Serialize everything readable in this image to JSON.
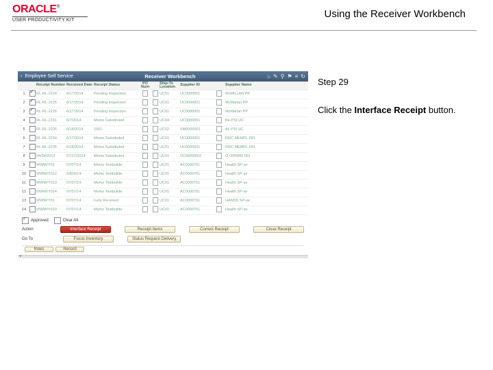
{
  "brand": {
    "name": "ORACLE",
    "tm": "®",
    "sub": "USER PRODUCTIVITY KIT"
  },
  "doc_title": "Using the Receiver Workbench",
  "step": {
    "label": "Step 29",
    "line1": "Click the ",
    "bold": "Interface Receipt",
    "line2": " button."
  },
  "titlebar": {
    "back": "‹",
    "left": "Employee Self Service",
    "center": "Receiver Workbench"
  },
  "icons": {
    "home": "⌂",
    "chat": "✎",
    "search": "⚲",
    "flag": "⚑",
    "menu": "≡",
    "refresh": "↻"
  },
  "columns": [
    "",
    "",
    "Receipt Number",
    "Received Date",
    "Receipt Status",
    "PO Num",
    "",
    "Ship-To Location",
    "Supplier ID",
    "",
    "Supplier Name"
  ],
  "rows": [
    {
      "n": "1",
      "chk": true,
      "a": "RL-RL-2224",
      "b": "6/17/2014",
      "c": "Pending Inspection",
      "f": "UC01",
      "g": "UC0000001",
      "i": "McMILLAN PP"
    },
    {
      "n": "2",
      "chk": true,
      "a": "RL-RL-2225",
      "b": "6/17/2014",
      "c": "Pending Inspection",
      "f": "UC01",
      "g": "UC0000001",
      "i": "McMahan PP"
    },
    {
      "n": "3",
      "chk": true,
      "a": "RL-RL-2226",
      "b": "6/17/2014",
      "c": "Pending Inspection",
      "f": "UC01",
      "g": "UC0000001",
      "i": "McMahan PP"
    },
    {
      "n": "4",
      "chk": false,
      "a": "RL-RL-2151",
      "b": "6/7/2014",
      "c": "Memo Substituted",
      "f": "UC04",
      "g": "UC0000001",
      "i": "Be-PSI UC"
    },
    {
      "n": "5",
      "chk": false,
      "a": "RL-RL-2226",
      "b": "6/18/2014",
      "c": "1061",
      "f": "UC02",
      "g": "SM0000001",
      "i": "AL PSI UC"
    },
    {
      "n": "6",
      "chk": false,
      "a": "RL-RL-2234",
      "b": "6/17/2014",
      "c": "Memo Substituted",
      "f": "UC01",
      "g": "UC0000001",
      "i": "RRC MEMPL-091"
    },
    {
      "n": "7",
      "chk": false,
      "a": "RL-RL-2235",
      "b": "6/18/2014",
      "c": "Memo Substituted",
      "f": "UC01",
      "g": "UC0000001",
      "i": "RRC MEMPL-091"
    },
    {
      "n": "8",
      "chk": false,
      "a": "94/34/2013",
      "b": "07/21/2014",
      "c": "Memo Substituted",
      "f": "UC01",
      "g": "OCM000002",
      "i": "O-ORNRD 001"
    },
    {
      "n": "9",
      "chk": false,
      "a": "WWW/Y01",
      "b": "07/07/14",
      "c": "Memo Testbuilde",
      "f": "UC01",
      "g": "AC0000701",
      "i": "Health SP-se"
    },
    {
      "n": "10",
      "chk": false,
      "a": "WWW/Y012",
      "b": "6/8/2014",
      "c": "Memo Testbuilde",
      "f": "UC01",
      "g": "AC0000701",
      "i": "Health SP-se"
    },
    {
      "n": "11",
      "chk": false,
      "a": "WWW/Y013",
      "b": "07/07/14",
      "c": "Memo Testbuilde",
      "f": "UC01",
      "g": "AC0000701",
      "i": "Health SP-se"
    },
    {
      "n": "12",
      "chk": false,
      "a": "WWW/Y014",
      "b": "07/07/14",
      "c": "Memo Testbuilde",
      "f": "UC01",
      "g": "AC0000701",
      "i": "Health SP-se"
    },
    {
      "n": "13",
      "chk": false,
      "a": "WWW/Y01",
      "b": "07/07/14",
      "c": "Fully Received",
      "f": "UC01",
      "g": "AC0000701",
      "i": "HANNS SP-se"
    },
    {
      "n": "14",
      "chk": false,
      "a": "WWW/Y019",
      "b": "07/07/14",
      "c": "Memo Testbuilde",
      "f": "UC01",
      "g": "AC0000701",
      "i": "Health SP-se"
    }
  ],
  "foot": {
    "approved": "Approved",
    "clear": "Clear All",
    "action_lbl": "Action",
    "goto_lbl": "Go To",
    "buttons": {
      "interface": "Interface Receipt",
      "items": "Receipt Items",
      "correct": "Correct Receipt",
      "close": "Close Receipt",
      "focus": "Focus Inventory",
      "status": "Status Request Delivery"
    },
    "toolbar": {
      "rows": "Rows",
      "record": "Record"
    }
  }
}
